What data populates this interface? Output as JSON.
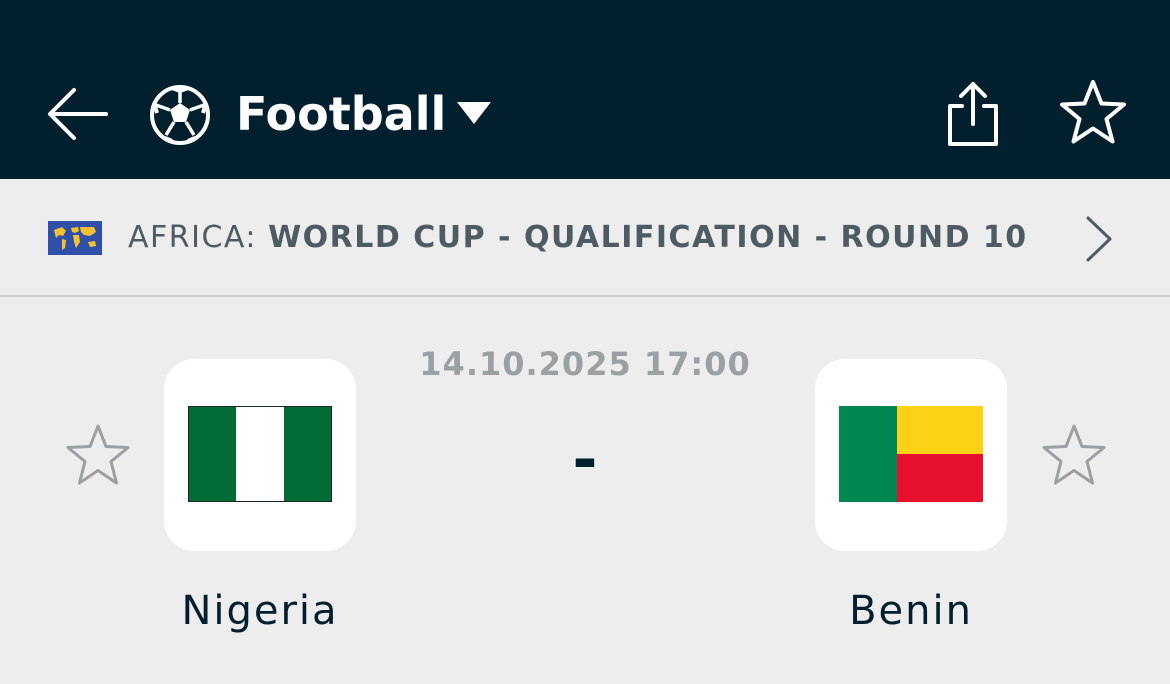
{
  "header": {
    "sport_label": "Football",
    "back_icon": "arrow-left-icon",
    "sport_icon": "soccer-ball-icon",
    "dropdown_icon": "caret-down-icon",
    "share_icon": "share-icon",
    "favorite_icon": "star-outline-icon",
    "background_color": "#011f2c"
  },
  "league": {
    "flag_icon": "world-map-flag-icon",
    "region": "AFRICA:",
    "name": "WORLD CUP - QUALIFICATION - ROUND 10",
    "chevron_icon": "chevron-right-icon"
  },
  "match": {
    "datetime": "14.10.2025 17:00",
    "score": "-",
    "home": {
      "name": "Nigeria",
      "flag_colors": [
        "#006b35",
        "#ffffff",
        "#006b35"
      ],
      "favorite_icon": "star-outline-icon"
    },
    "away": {
      "name": "Benin",
      "flag_colors": [
        "#008751",
        "#fcd116",
        "#e8112d"
      ],
      "favorite_icon": "star-outline-icon"
    }
  }
}
